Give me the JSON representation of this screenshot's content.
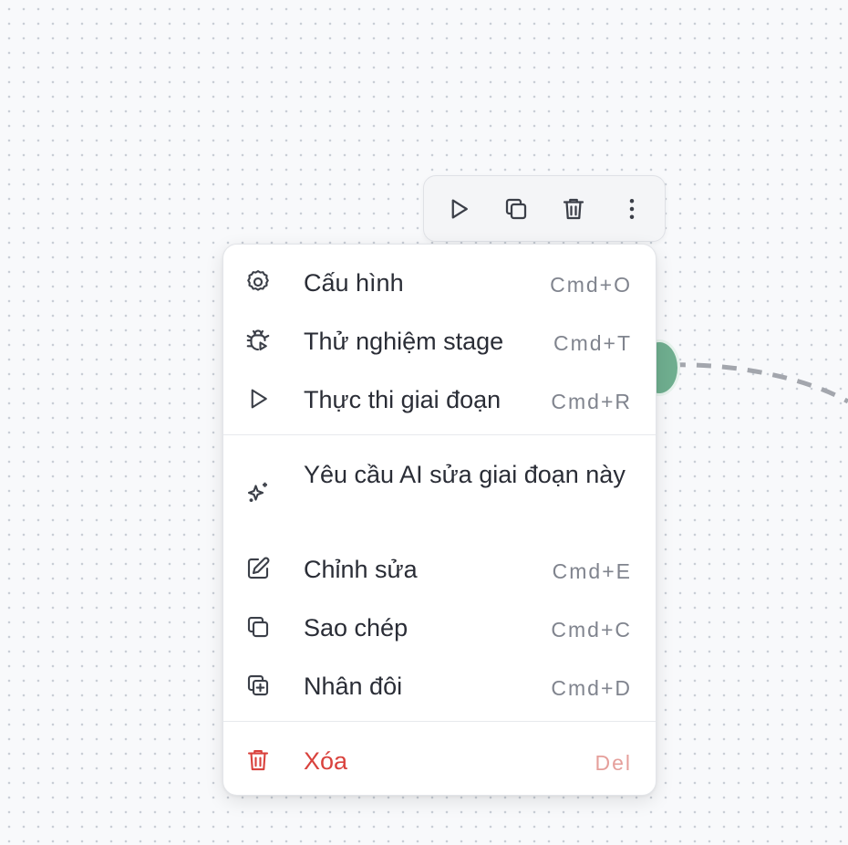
{
  "toolbar": {
    "buttons": [
      {
        "name": "run-icon"
      },
      {
        "name": "copy-icon"
      },
      {
        "name": "trash-icon"
      },
      {
        "name": "more-vertical-icon"
      }
    ]
  },
  "menu": {
    "items": [
      {
        "label": "Cấu hình",
        "shortcut": "Cmd+O",
        "icon": "gear-icon"
      },
      {
        "label": "Thử nghiệm stage",
        "shortcut": "Cmd+T",
        "icon": "bug-play-icon"
      },
      {
        "label": "Thực thi giai đoạn",
        "shortcut": "Cmd+R",
        "icon": "play-icon"
      },
      {
        "label": "Yêu cầu AI sửa giai đoạn này",
        "shortcut": "",
        "icon": "sparkles-icon"
      },
      {
        "label": "Chỉnh sửa",
        "shortcut": "Cmd+E",
        "icon": "edit-icon"
      },
      {
        "label": "Sao chép",
        "shortcut": "Cmd+C",
        "icon": "copy-icon"
      },
      {
        "label": "Nhân đôi",
        "shortcut": "Cmd+D",
        "icon": "duplicate-icon"
      },
      {
        "label": "Xóa",
        "shortcut": "Del",
        "icon": "trash-icon"
      }
    ]
  },
  "colors": {
    "danger": "#d9423d",
    "node_handle": "#6fae8f"
  }
}
